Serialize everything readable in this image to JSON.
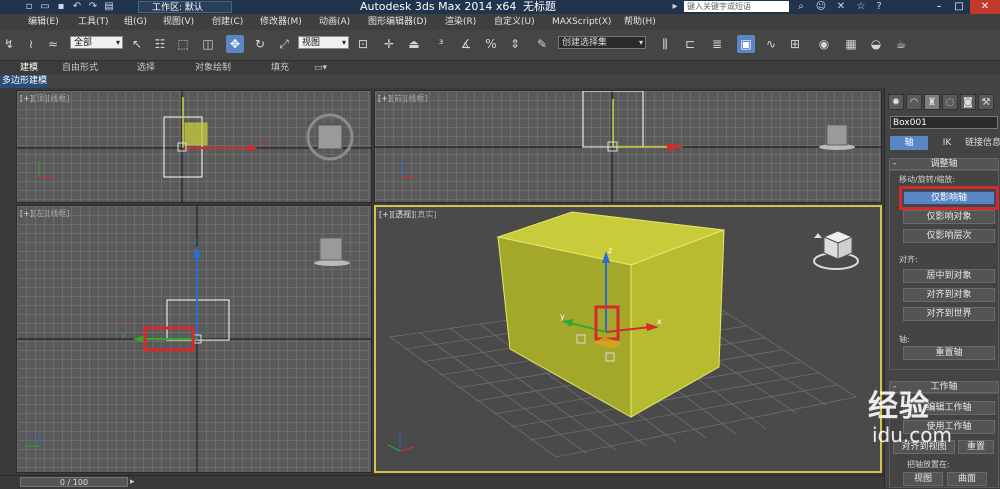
{
  "titlebar": {
    "workspace_label": "工作区: 默认",
    "title": "Autodesk 3ds Max  2014 x64",
    "document": "无标题",
    "search_placeholder": "键入关键字或短语"
  },
  "menu": [
    "编辑(E)",
    "工具(T)",
    "组(G)",
    "视图(V)",
    "创建(C)",
    "修改器(M)",
    "动画(A)",
    "图形编辑器(D)",
    "渲染(R)",
    "自定义(U)",
    "MAXScript(X)",
    "帮助(H)"
  ],
  "toolbar": {
    "filter_value": "全部",
    "coord_value": "视图",
    "selection_set_value": "创建选择集"
  },
  "ribbon": {
    "tabs": [
      "建模",
      "自由形式",
      "选择",
      "对象绘制",
      "填充"
    ],
    "active_panel": "多边形建模"
  },
  "viewports": {
    "top": {
      "l1": "[+]",
      "l2": "[顶]",
      "l3": "[线框]"
    },
    "front": {
      "l1": "[+]",
      "l2": "[前]",
      "l3": "[线框]"
    },
    "left": {
      "l1": "[+]",
      "l2": "[左]",
      "l3": "[线框]"
    },
    "persp": {
      "l1": "[+]",
      "l2": "[透视]",
      "l3": "[真实]"
    },
    "axis_x": "x",
    "axis_y": "y",
    "axis_z": "z"
  },
  "command_panel": {
    "object_name": "Box001",
    "subtabs": [
      "轴",
      "IK",
      "链接信息"
    ],
    "adjust_pivot": {
      "title": "调整轴",
      "move_group": "移动/旋转/缩放:",
      "btn_pivot_only": "仅影响轴",
      "btn_object_only": "仅影响对象",
      "btn_hierarchy_only": "仅影响层次",
      "align_group": "对齐:",
      "btn_center": "居中到对象",
      "btn_align_object": "对齐到对象",
      "btn_align_world": "对齐到世界",
      "pivot_group": "轴:",
      "btn_reset_pivot": "重置轴"
    },
    "working_pivot": {
      "title": "工作轴",
      "btn_edit": "编辑工作轴",
      "btn_use": "使用工作轴",
      "align_view": "对齐到视图",
      "reset": "重置",
      "placement_label": "把轴放置在:",
      "view": "视图",
      "surface": "曲面"
    }
  },
  "status": {
    "time_slider": "0 / 100"
  },
  "watermark": {
    "line1": "经验",
    "line2": "idu.com"
  },
  "colors": {
    "highlight": "#d42a2a",
    "box_yellow": "#c8cc3a",
    "accent": "#5a86c4"
  }
}
